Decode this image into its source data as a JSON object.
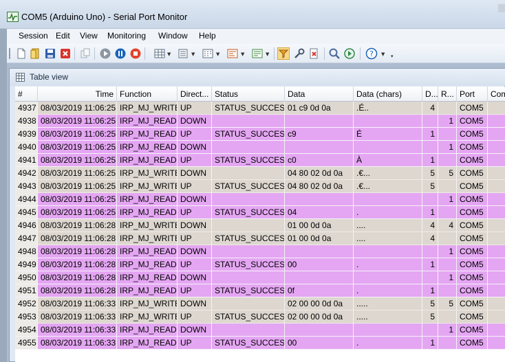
{
  "window": {
    "title": "COM5 (Arduino Uno) - Serial Port Monitor"
  },
  "menu": [
    "Session",
    "Edit",
    "View",
    "Monitoring",
    "Window",
    "Help"
  ],
  "toolbar": {
    "icons": [
      "new-session-icon",
      "open-icon",
      "save-icon",
      "close-session-icon",
      "copy-icon",
      "start-icon",
      "pause-icon",
      "stop-icon",
      "table-view-icon",
      "line-view-icon",
      "dump-view-icon",
      "terminal-view-icon",
      "modbus-view-icon",
      "filter-icon",
      "settings-icon",
      "clear-icon",
      "search-icon",
      "go-icon",
      "help-icon"
    ]
  },
  "table_window": {
    "title": "Table view"
  },
  "grid": {
    "columns": [
      "#",
      "Time",
      "Function",
      "Direct...",
      "Status",
      "Data",
      "Data (chars)",
      "D...",
      "R...",
      "Port",
      "Com"
    ],
    "rows": [
      {
        "id": "4937",
        "time": "08/03/2019 11:06:25",
        "func": "IRP_MJ_WRITE",
        "dir": "UP",
        "status": "STATUS_SUCCESS",
        "data": "01 c9 0d 0a",
        "chars": ".É..",
        "d": "4",
        "r": "",
        "port": "COM5"
      },
      {
        "id": "4938",
        "time": "08/03/2019 11:06:25",
        "func": "IRP_MJ_READ",
        "dir": "DOWN",
        "status": "",
        "data": "",
        "chars": "",
        "d": "",
        "r": "1",
        "port": "COM5"
      },
      {
        "id": "4939",
        "time": "08/03/2019 11:06:25",
        "func": "IRP_MJ_READ",
        "dir": "UP",
        "status": "STATUS_SUCCESS",
        "data": "c9",
        "chars": "É",
        "d": "1",
        "r": "",
        "port": "COM5"
      },
      {
        "id": "4940",
        "time": "08/03/2019 11:06:25",
        "func": "IRP_MJ_READ",
        "dir": "DOWN",
        "status": "",
        "data": "",
        "chars": "",
        "d": "",
        "r": "1",
        "port": "COM5"
      },
      {
        "id": "4941",
        "time": "08/03/2019 11:06:25",
        "func": "IRP_MJ_READ",
        "dir": "UP",
        "status": "STATUS_SUCCESS",
        "data": "c0",
        "chars": "À",
        "d": "1",
        "r": "",
        "port": "COM5"
      },
      {
        "id": "4942",
        "time": "08/03/2019 11:06:25",
        "func": "IRP_MJ_WRITE",
        "dir": "DOWN",
        "status": "",
        "data": "04 80 02 0d 0a",
        "chars": ".€...",
        "d": "5",
        "r": "5",
        "port": "COM5"
      },
      {
        "id": "4943",
        "time": "08/03/2019 11:06:25",
        "func": "IRP_MJ_WRITE",
        "dir": "UP",
        "status": "STATUS_SUCCESS",
        "data": "04 80 02 0d 0a",
        "chars": ".€...",
        "d": "5",
        "r": "",
        "port": "COM5"
      },
      {
        "id": "4944",
        "time": "08/03/2019 11:06:25",
        "func": "IRP_MJ_READ",
        "dir": "DOWN",
        "status": "",
        "data": "",
        "chars": "",
        "d": "",
        "r": "1",
        "port": "COM5"
      },
      {
        "id": "4945",
        "time": "08/03/2019 11:06:25",
        "func": "IRP_MJ_READ",
        "dir": "UP",
        "status": "STATUS_SUCCESS",
        "data": "04",
        "chars": ".",
        "d": "1",
        "r": "",
        "port": "COM5"
      },
      {
        "id": "4946",
        "time": "08/03/2019 11:06:28",
        "func": "IRP_MJ_WRITE",
        "dir": "DOWN",
        "status": "",
        "data": "01 00 0d 0a",
        "chars": "....",
        "d": "4",
        "r": "4",
        "port": "COM5"
      },
      {
        "id": "4947",
        "time": "08/03/2019 11:06:28",
        "func": "IRP_MJ_WRITE",
        "dir": "UP",
        "status": "STATUS_SUCCESS",
        "data": "01 00 0d 0a",
        "chars": "....",
        "d": "4",
        "r": "",
        "port": "COM5"
      },
      {
        "id": "4948",
        "time": "08/03/2019 11:06:28",
        "func": "IRP_MJ_READ",
        "dir": "DOWN",
        "status": "",
        "data": "",
        "chars": "",
        "d": "",
        "r": "1",
        "port": "COM5"
      },
      {
        "id": "4949",
        "time": "08/03/2019 11:06:28",
        "func": "IRP_MJ_READ",
        "dir": "UP",
        "status": "STATUS_SUCCESS",
        "data": "00",
        "chars": ".",
        "d": "1",
        "r": "",
        "port": "COM5"
      },
      {
        "id": "4950",
        "time": "08/03/2019 11:06:28",
        "func": "IRP_MJ_READ",
        "dir": "DOWN",
        "status": "",
        "data": "",
        "chars": "",
        "d": "",
        "r": "1",
        "port": "COM5"
      },
      {
        "id": "4951",
        "time": "08/03/2019 11:06:28",
        "func": "IRP_MJ_READ",
        "dir": "UP",
        "status": "STATUS_SUCCESS",
        "data": "0f",
        "chars": ".",
        "d": "1",
        "r": "",
        "port": "COM5"
      },
      {
        "id": "4952",
        "time": "08/03/2019 11:06:33",
        "func": "IRP_MJ_WRITE",
        "dir": "DOWN",
        "status": "",
        "data": "02 00 00 0d 0a",
        "chars": ".....",
        "d": "5",
        "r": "5",
        "port": "COM5"
      },
      {
        "id": "4953",
        "time": "08/03/2019 11:06:33",
        "func": "IRP_MJ_WRITE",
        "dir": "UP",
        "status": "STATUS_SUCCESS",
        "data": "02 00 00 0d 0a",
        "chars": ".....",
        "d": "5",
        "r": "",
        "port": "COM5"
      },
      {
        "id": "4954",
        "time": "08/03/2019 11:06:33",
        "func": "IRP_MJ_READ",
        "dir": "DOWN",
        "status": "",
        "data": "",
        "chars": "",
        "d": "",
        "r": "1",
        "port": "COM5"
      },
      {
        "id": "4955",
        "time": "08/03/2019 11:06:33",
        "func": "IRP_MJ_READ",
        "dir": "UP",
        "status": "STATUS_SUCCESS",
        "data": "00",
        "chars": ".",
        "d": "1",
        "r": "",
        "port": "COM5"
      }
    ]
  },
  "colors": {
    "read_row": "#e4a6f2",
    "write_row": "#ddd7cf"
  }
}
